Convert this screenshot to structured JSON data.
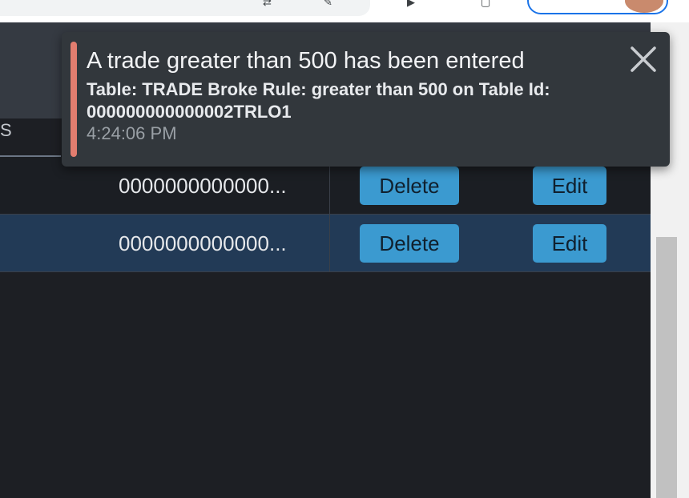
{
  "browser": {
    "icons": [
      "translate-icon",
      "extensions-icon",
      "play-icon",
      "tab-icon"
    ]
  },
  "table": {
    "tab_label": "S",
    "rows": [
      {
        "id": "0000000000000...",
        "delete_label": "Delete",
        "edit_label": "Edit",
        "selected": false
      },
      {
        "id": "0000000000000...",
        "delete_label": "Delete",
        "edit_label": "Edit",
        "selected": true
      }
    ]
  },
  "toast": {
    "title": "A trade greater than 500 has been entered",
    "body": "Table: TRADE Broke Rule: greater than 500 on Table Id: 000000000000002TRLO1",
    "time": "4:24:06 PM",
    "accent_color": "#e27d6f",
    "close_icon": "close-icon"
  },
  "colors": {
    "button_bg": "#3b9ad0",
    "selected_row_bg": "#223a56",
    "background": "#1d1f24"
  }
}
